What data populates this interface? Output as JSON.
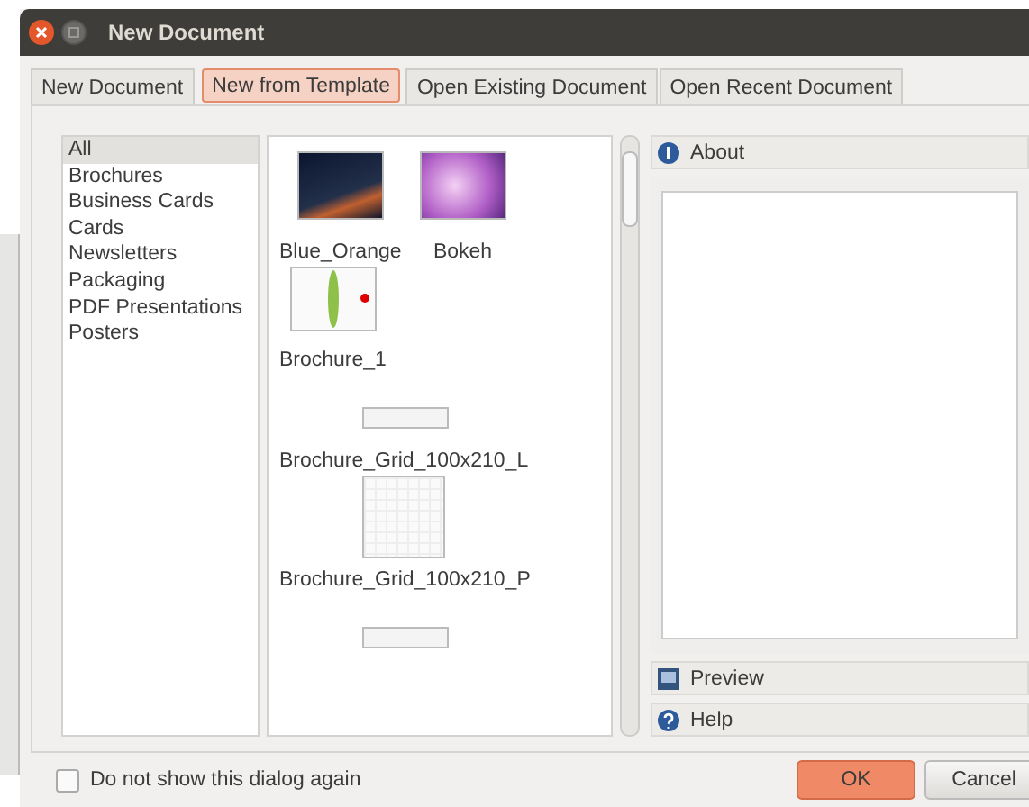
{
  "window": {
    "title": "New Document"
  },
  "tabs": [
    {
      "label": "New Document",
      "selected": false
    },
    {
      "label": "New from Template",
      "selected": true
    },
    {
      "label": "Open Existing Document",
      "selected": false
    },
    {
      "label": "Open Recent Document",
      "selected": false
    }
  ],
  "categories": [
    {
      "label": "All",
      "selected": true
    },
    {
      "label": "Brochures",
      "selected": false
    },
    {
      "label": "Business Cards",
      "selected": false
    },
    {
      "label": "Cards",
      "selected": false
    },
    {
      "label": "Newsletters",
      "selected": false
    },
    {
      "label": "Packaging",
      "selected": false
    },
    {
      "label": "PDF Presentations",
      "selected": false
    },
    {
      "label": "Posters",
      "selected": false
    }
  ],
  "templates": [
    {
      "name": "Blue_Orange",
      "kind": "dark-photo"
    },
    {
      "name": "Bokeh",
      "kind": "pink-photo"
    },
    {
      "name": "Brochure_1",
      "kind": "brochure"
    },
    {
      "name": "Brochure_Grid_100x210_L",
      "kind": "strip"
    },
    {
      "name": "Brochure_Grid_100x210_P",
      "kind": "page"
    },
    {
      "kind": "strip"
    }
  ],
  "side_panels": [
    {
      "label": "About",
      "kind": "info"
    },
    {
      "label": "Preview",
      "kind": "preview"
    },
    {
      "label": "Help",
      "kind": "help"
    }
  ],
  "dont_show_again": {
    "label": "Do not show this dialog again",
    "checked": false
  },
  "buttons": [
    {
      "label": "OK",
      "kind": "primary"
    },
    {
      "label": "Cancel",
      "kind": "normal"
    }
  ]
}
